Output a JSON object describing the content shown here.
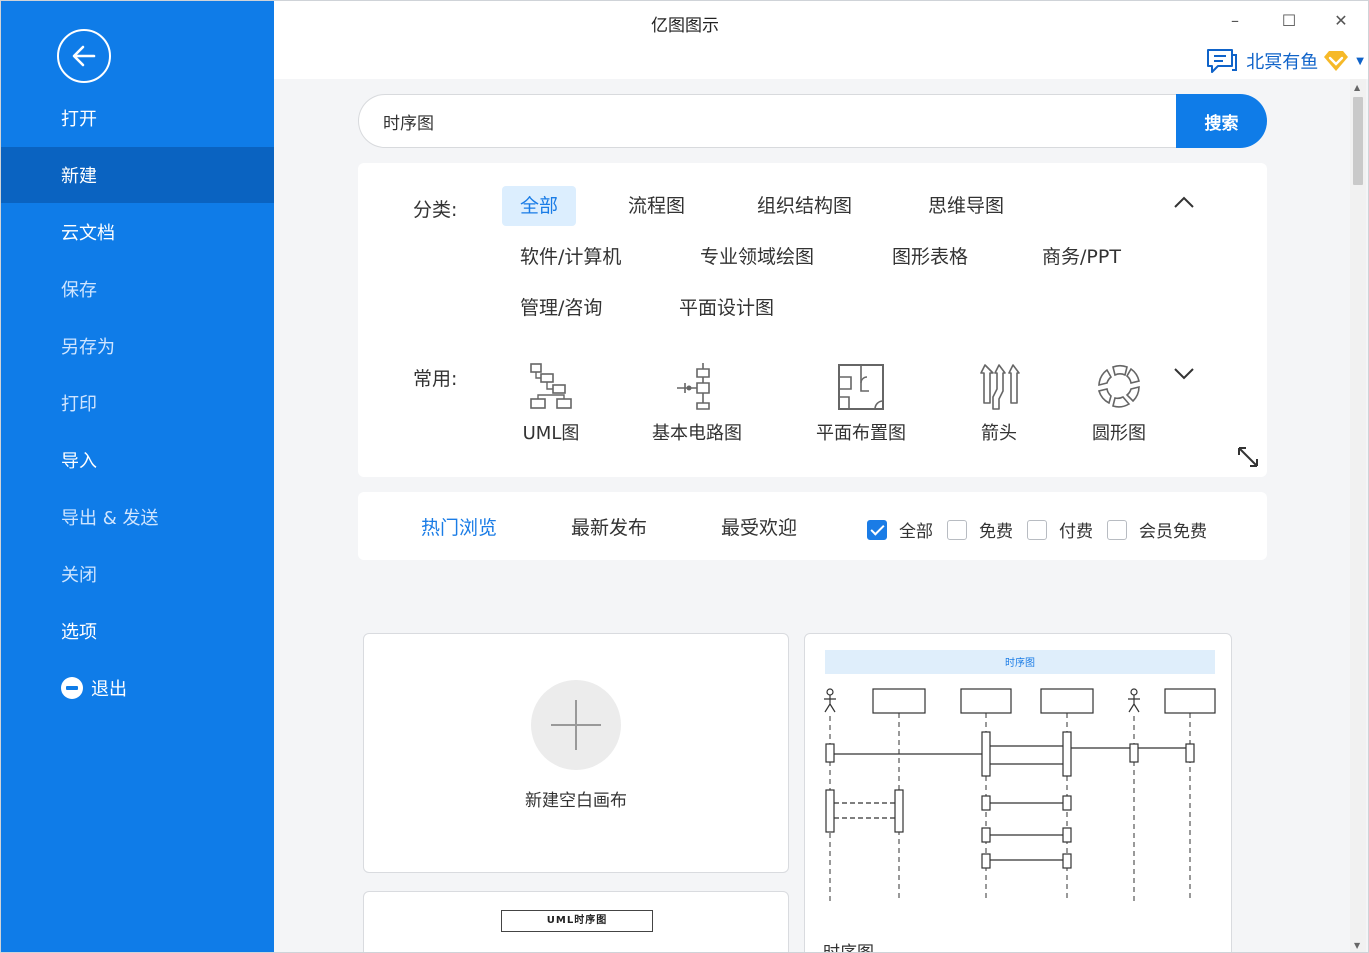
{
  "window": {
    "title": "亿图图示",
    "minimize": "–",
    "maximize": "☐",
    "close": "✕"
  },
  "user": {
    "name": "北冥有鱼"
  },
  "sidebar": {
    "items": [
      {
        "label": "打开"
      },
      {
        "label": "新建"
      },
      {
        "label": "云文档"
      },
      {
        "label": "保存"
      },
      {
        "label": "另存为"
      },
      {
        "label": "打印"
      },
      {
        "label": "导入"
      },
      {
        "label": "导出 & 发送"
      },
      {
        "label": "关闭"
      },
      {
        "label": "选项"
      },
      {
        "label": "退出"
      }
    ]
  },
  "search": {
    "value": "时序图",
    "button": "搜索"
  },
  "categories": {
    "label": "分类:",
    "tags": [
      "全部",
      "流程图",
      "组织结构图",
      "思维导图",
      "软件/计算机",
      "专业领域绘图",
      "图形表格",
      "商务/PPT",
      "管理/咨询",
      "平面设计图"
    ]
  },
  "common": {
    "label": "常用:",
    "items": [
      {
        "label": "UML图",
        "icon": "uml-icon"
      },
      {
        "label": "基本电路图",
        "icon": "circuit-icon"
      },
      {
        "label": "平面布置图",
        "icon": "floorplan-icon"
      },
      {
        "label": "箭头",
        "icon": "arrow-shapes-icon"
      },
      {
        "label": "圆形图",
        "icon": "circular-diagram-icon"
      }
    ]
  },
  "tabs": [
    "热门浏览",
    "最新发布",
    "最受欢迎"
  ],
  "filters": [
    {
      "label": "全部",
      "checked": true
    },
    {
      "label": "免费",
      "checked": false
    },
    {
      "label": "付费",
      "checked": false
    },
    {
      "label": "会员免费",
      "checked": false
    }
  ],
  "cards": {
    "new_blank": "新建空白画布",
    "sequence": {
      "label": "时序图",
      "preview_title": "时序图"
    },
    "uml_preview_title": "UML时序图"
  },
  "colors": {
    "sidebar": "#0f7ce8",
    "sidebar_active": "#0a63c1",
    "accent": "#1a7ce6"
  }
}
